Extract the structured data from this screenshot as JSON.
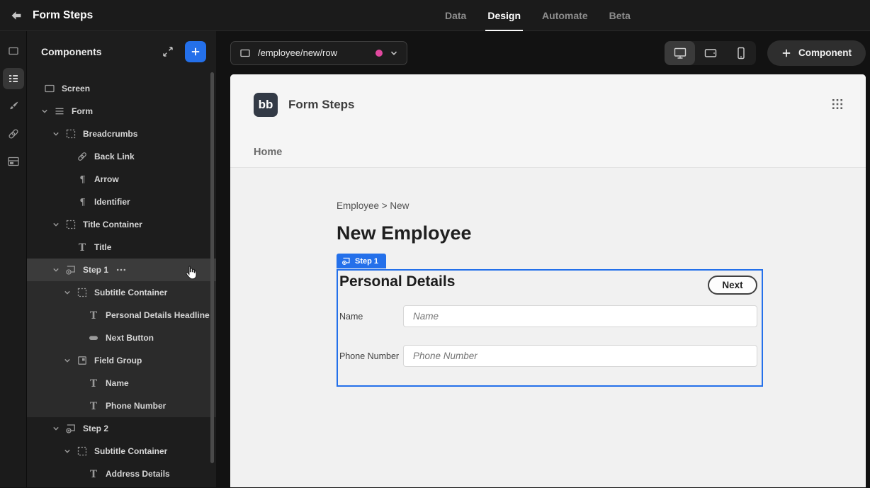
{
  "colors": {
    "accent_blue": "#2470ea",
    "url_dot_pink": "#e0489e",
    "panel_bg": "#1d1d1d",
    "selected_row": "#3b3b3b",
    "subtree_highlight": "#2b2b2b",
    "preview_bg": "#f1f1f1"
  },
  "topbar": {
    "title": "Form Steps",
    "back_icon": "back-arrow-icon",
    "tabs": [
      {
        "label": "Data",
        "active": false
      },
      {
        "label": "Design",
        "active": true
      },
      {
        "label": "Automate",
        "active": false
      },
      {
        "label": "Beta",
        "active": false
      }
    ]
  },
  "rail": {
    "items": [
      {
        "icon": "screen-icon",
        "active": false
      },
      {
        "icon": "component-tree-icon",
        "active": true
      },
      {
        "icon": "theme-brush-icon",
        "active": false
      },
      {
        "icon": "navigation-link-icon",
        "active": false
      },
      {
        "icon": "layout-icon",
        "active": false
      }
    ]
  },
  "components_panel": {
    "title": "Components",
    "expand_icon": "expand-icon",
    "add_icon": "plus-icon",
    "tree": [
      {
        "label": "Screen",
        "icon": "screen-icon",
        "indent": 24,
        "chevron": false,
        "state": ""
      },
      {
        "label": "Form",
        "icon": "form-icon",
        "indent": 20,
        "chevron": true,
        "state": ""
      },
      {
        "label": "Breadcrumbs",
        "icon": "container-icon",
        "indent": 36,
        "chevron": true,
        "state": ""
      },
      {
        "label": "Back Link",
        "icon": "link-icon",
        "indent": 70,
        "chevron": false,
        "state": ""
      },
      {
        "label": "Arrow",
        "icon": "paragraph-icon",
        "indent": 70,
        "chevron": false,
        "state": ""
      },
      {
        "label": "Identifier",
        "icon": "paragraph-icon",
        "indent": 70,
        "chevron": false,
        "state": ""
      },
      {
        "label": "Title Container",
        "icon": "container-icon",
        "indent": 36,
        "chevron": true,
        "state": ""
      },
      {
        "label": "Title",
        "icon": "text-icon",
        "indent": 70,
        "chevron": false,
        "state": ""
      },
      {
        "label": "Step 1",
        "icon": "step-icon",
        "indent": 36,
        "chevron": true,
        "state": "selected",
        "more": true
      },
      {
        "label": "Subtitle Container",
        "icon": "container-icon",
        "indent": 52,
        "chevron": true,
        "state": "highlight"
      },
      {
        "label": "Personal Details Headline",
        "icon": "text-icon",
        "indent": 86,
        "chevron": false,
        "state": "highlight"
      },
      {
        "label": "Next Button",
        "icon": "button-icon",
        "indent": 86,
        "chevron": false,
        "state": "highlight"
      },
      {
        "label": "Field Group",
        "icon": "fieldgroup-icon",
        "indent": 52,
        "chevron": true,
        "state": "highlight"
      },
      {
        "label": "Name",
        "icon": "text-icon",
        "indent": 86,
        "chevron": false,
        "state": "highlight"
      },
      {
        "label": "Phone Number",
        "icon": "text-icon",
        "indent": 86,
        "chevron": false,
        "state": "highlight"
      },
      {
        "label": "Step 2",
        "icon": "step-icon",
        "indent": 36,
        "chevron": true,
        "state": ""
      },
      {
        "label": "Subtitle Container",
        "icon": "container-icon",
        "indent": 52,
        "chevron": true,
        "state": ""
      },
      {
        "label": "Address Details",
        "icon": "text-icon",
        "indent": 86,
        "chevron": false,
        "state": ""
      }
    ]
  },
  "toolbar": {
    "url_route": "/employee/new/row",
    "url_icon": "screen-icon",
    "devices": [
      {
        "icon": "desktop-icon",
        "active": true
      },
      {
        "icon": "tablet-icon",
        "active": false
      },
      {
        "icon": "mobile-icon",
        "active": false
      }
    ],
    "component_button_label": "Component"
  },
  "preview": {
    "logo_text": "bb",
    "app_title": "Form Steps",
    "apps_grid_icon": "grid-dots-icon",
    "nav_home": "Home",
    "breadcrumb": "Employee > New",
    "heading": "New Employee",
    "step_tag": "Step 1",
    "form": {
      "title": "Personal Details",
      "next_label": "Next",
      "fields": [
        {
          "label": "Name",
          "placeholder": "Name"
        },
        {
          "label": "Phone Number",
          "placeholder": "Phone Number"
        }
      ]
    }
  }
}
